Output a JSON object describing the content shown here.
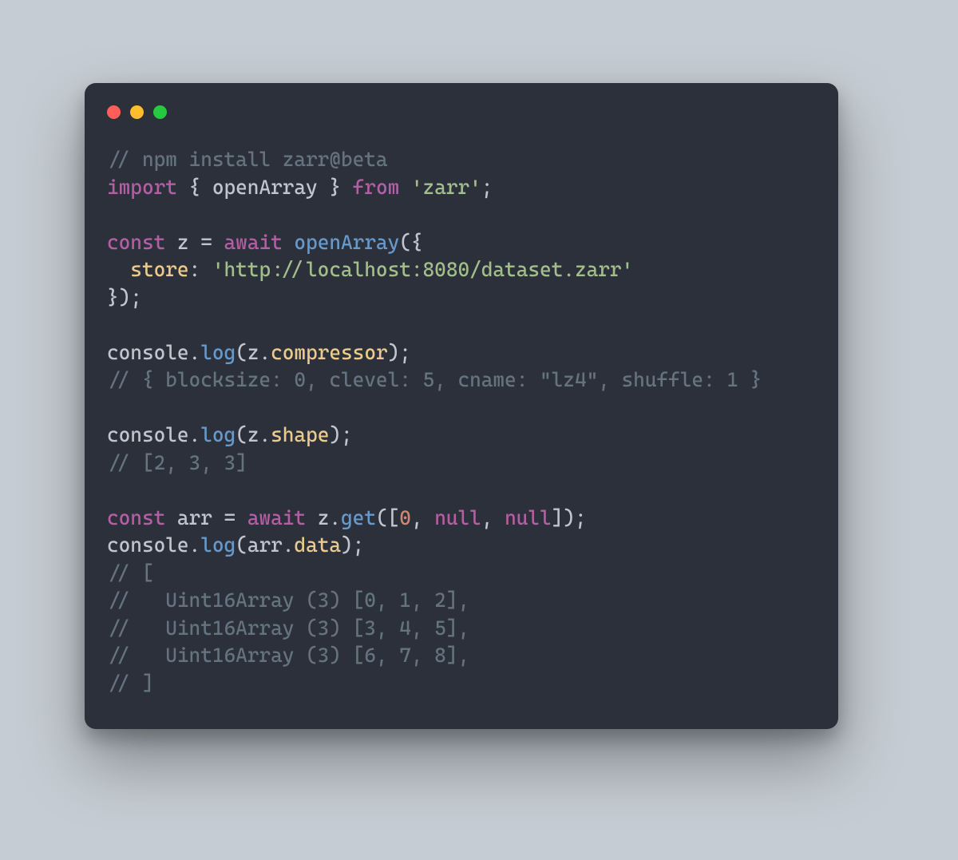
{
  "traffic": {
    "red": "#ff5f56",
    "yellow": "#ffbd2e",
    "green": "#27c93f"
  },
  "code": {
    "l01_comment": "// npm install zarr@beta",
    "l02_import": "import",
    "l02_lbrace": " { ",
    "l02_open": "openArray",
    "l02_rbrace": " } ",
    "l02_from": "from",
    "l02_sp": " ",
    "l02_mod": "'zarr'",
    "l02_semi": ";",
    "l04_const": "const",
    "l04_sp1": " ",
    "l04_z": "z",
    "l04_eq": " = ",
    "l04_await": "await",
    "l04_sp2": " ",
    "l04_openArray": "openArray",
    "l04_call": "({",
    "l05_indent": "  ",
    "l05_store": "store",
    "l05_colon": ": ",
    "l05_url": "'http://localhost:8080/dataset.zarr'",
    "l06_close": "});",
    "l08_console": "console",
    "l08_dot": ".",
    "l08_log": "log",
    "l08_open": "(",
    "l08_z": "z",
    "l08_dot2": ".",
    "l08_comp": "compressor",
    "l08_close": ");",
    "l09_comment": "// { blocksize: 0, clevel: 5, cname: \"lz4\", shuffle: 1 }",
    "l11_console": "console",
    "l11_dot": ".",
    "l11_log": "log",
    "l11_open": "(",
    "l11_z": "z",
    "l11_dot2": ".",
    "l11_shape": "shape",
    "l11_close": ");",
    "l12_comment": "// [2, 3, 3]",
    "l14_const": "const",
    "l14_sp": " ",
    "l14_arr": "arr",
    "l14_eq": " = ",
    "l14_await": "await",
    "l14_sp2": " ",
    "l14_z": "z",
    "l14_dot": ".",
    "l14_get": "get",
    "l14_open": "([",
    "l14_zero": "0",
    "l14_comma1": ", ",
    "l14_null1": "null",
    "l14_comma2": ", ",
    "l14_null2": "null",
    "l14_close": "]);",
    "l15_console": "console",
    "l15_dot": ".",
    "l15_log": "log",
    "l15_open": "(",
    "l15_arr": "arr",
    "l15_dot2": ".",
    "l15_data": "data",
    "l15_close": ");",
    "l16": "// [",
    "l17": "//   Uint16Array (3) [0, 1, 2],",
    "l18": "//   Uint16Array (3) [3, 4, 5],",
    "l19": "//   Uint16Array (3) [6, 7, 8],",
    "l20": "// ]"
  }
}
